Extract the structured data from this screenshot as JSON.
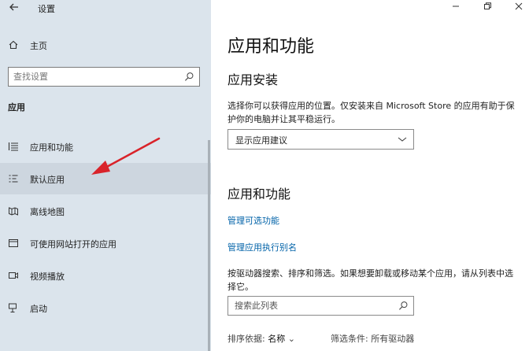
{
  "window": {
    "title": "设置"
  },
  "sidebar": {
    "home_label": "主页",
    "search_placeholder": "查找设置",
    "section_label": "应用",
    "items": [
      {
        "label": "应用和功能",
        "icon": "list-icon"
      },
      {
        "label": "默认应用",
        "icon": "default-apps-icon"
      },
      {
        "label": "离线地图",
        "icon": "map-icon"
      },
      {
        "label": "可使用网站打开的应用",
        "icon": "web-apps-icon"
      },
      {
        "label": "视频播放",
        "icon": "video-icon"
      },
      {
        "label": "启动",
        "icon": "startup-icon"
      }
    ]
  },
  "main": {
    "title": "应用和功能",
    "install_heading": "应用安装",
    "install_desc": "选择你可以获得应用的位置。仅安装来自 Microsoft Store 的应用有助于保护你的电脑并让其平稳运行。",
    "install_select_value": "显示应用建议",
    "apps_heading": "应用和功能",
    "link_optional_features": "管理可选功能",
    "link_aliases": "管理应用执行别名",
    "apps_desc": "按驱动器搜索、排序和筛选。如果想要卸载或移动某个应用，请从列表中选择它。",
    "list_search_placeholder": "搜索此列表",
    "sort_label": "排序依据:",
    "sort_value": "名称",
    "filter_label": "筛选条件:",
    "filter_value": "所有驱动器"
  },
  "colors": {
    "sidebar_bg": "#dbe4ec",
    "selected_bg": "#cdd6df",
    "link": "#0062a8",
    "arrow": "#d9232a"
  }
}
